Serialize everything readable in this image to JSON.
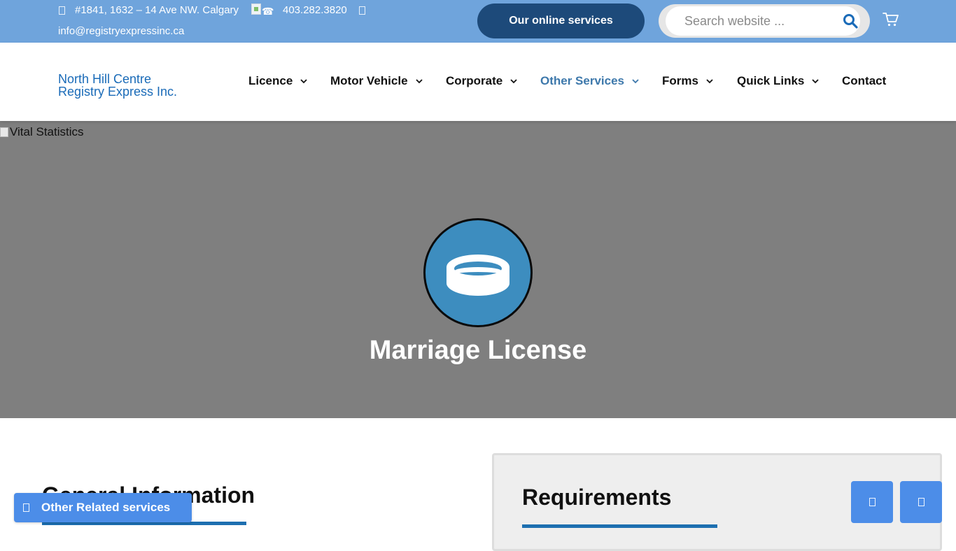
{
  "topbar": {
    "address": "#1841, 1632 – 14 Ave NW. Calgary",
    "phone": "403.282.3820",
    "email": "info@registryexpressinc.ca",
    "online_services_label": "Our online services",
    "search_placeholder": "Search website ..."
  },
  "header": {
    "logo_alt": "North Hill Centre Registry Express Inc.",
    "nav": [
      {
        "label": "Licence",
        "has_dropdown": true
      },
      {
        "label": "Motor Vehicle",
        "has_dropdown": true
      },
      {
        "label": "Corporate",
        "has_dropdown": true
      },
      {
        "label": "Other Services",
        "has_dropdown": true,
        "active": true
      },
      {
        "label": "Forms",
        "has_dropdown": true
      },
      {
        "label": "Quick Links",
        "has_dropdown": true
      },
      {
        "label": "Contact",
        "has_dropdown": false
      }
    ]
  },
  "hero": {
    "image_alt": "Vital Statistics",
    "icon": "ring-icon",
    "title": "Marriage License"
  },
  "content": {
    "general_title": "General Information",
    "requirements_title": "Requirements"
  },
  "floating": {
    "related_label": "Other Related services"
  },
  "colors": {
    "topbar": "#6fa4dc",
    "online_button": "#1d4a7a",
    "active_nav": "#3d78ab",
    "hero_bg": "#7f7f7f",
    "icon_circle": "#3d8dbf",
    "accent_underline": "#1d6fb0",
    "floating_button": "#4c8de8"
  }
}
